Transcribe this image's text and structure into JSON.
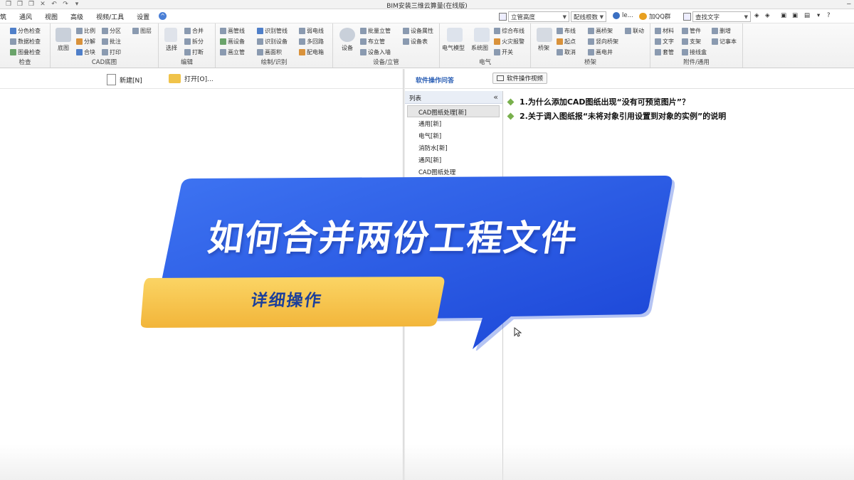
{
  "window": {
    "title": "BIM安装三维云算量(在线版)",
    "quick_access": [
      "❐",
      "❐",
      "❐",
      "✕",
      "↶",
      "↷",
      "▾"
    ],
    "control": "‒"
  },
  "menu": {
    "items": [
      "筑",
      "通风",
      "视图",
      "高级",
      "视频/工具",
      "设置"
    ],
    "collapse": "^"
  },
  "right_tools": {
    "combo1": "立管高度",
    "combo2": "配线根数",
    "user": "le...",
    "qq": "加QQ群",
    "search": "查找文字"
  },
  "ribbon": {
    "groups": [
      {
        "label": "检查",
        "items": [
          "分色检查",
          "数据检查",
          "图叠检查"
        ]
      },
      {
        "label": "CAD底图",
        "big": "底图",
        "items": [
          "比例",
          "分区",
          "图层",
          "分解",
          "批注",
          "合块",
          "打印"
        ]
      },
      {
        "label": "编辑",
        "big": "选择",
        "items": [
          "合并",
          "拆分",
          "打断"
        ]
      },
      {
        "label": "绘制/识别",
        "items": [
          "画管线",
          "识别管线",
          "弱电线",
          "画设备",
          "识别设备",
          "多回路",
          "画立管",
          "画面积",
          "配电箱"
        ]
      },
      {
        "label": "设备/立管",
        "big": "设备",
        "items": [
          "批量立管",
          "设备属性",
          "布立管",
          "设备表",
          "设备入墙"
        ]
      },
      {
        "label": "电气",
        "items": [
          "电气模型",
          "系统图",
          "综合布线",
          "火灾报警",
          "开关"
        ]
      },
      {
        "label": "桥架",
        "big": "桥架",
        "items": [
          "布线",
          "画桥架",
          "联动",
          "起点",
          "竖向桥架",
          "取消",
          "画电井"
        ]
      },
      {
        "label": "附件/通用",
        "items": [
          "材料",
          "管件",
          "删增",
          "文字",
          "支架",
          "记事本",
          "套管",
          "接线盒"
        ]
      }
    ]
  },
  "file_toolbar": {
    "new": "新建[N]",
    "open": "打开[O]..."
  },
  "help": {
    "title": "软件操作问答",
    "video_btn": "软件操作视频",
    "list_header": "列表",
    "list_collapse": "«",
    "list_items": [
      "CAD图纸处理[新]",
      "通用[新]",
      "电气[新]",
      "消防水[新]",
      "通风[新]",
      "CAD图纸处理"
    ],
    "faq": [
      "1.为什么添加CAD图纸出现“没有可预览图片”？",
      "2.关于调入图纸报“未将对象引用设置到对象的实例”的说明"
    ]
  },
  "banner": {
    "title": "如何合并两份工程文件",
    "subtitle": "详细操作"
  },
  "colors": {
    "banner_blue": "#1f4fe0",
    "banner_yellow": "#f6c34a",
    "accent_green": "#79b04d",
    "link_blue": "#2b5fb5"
  }
}
